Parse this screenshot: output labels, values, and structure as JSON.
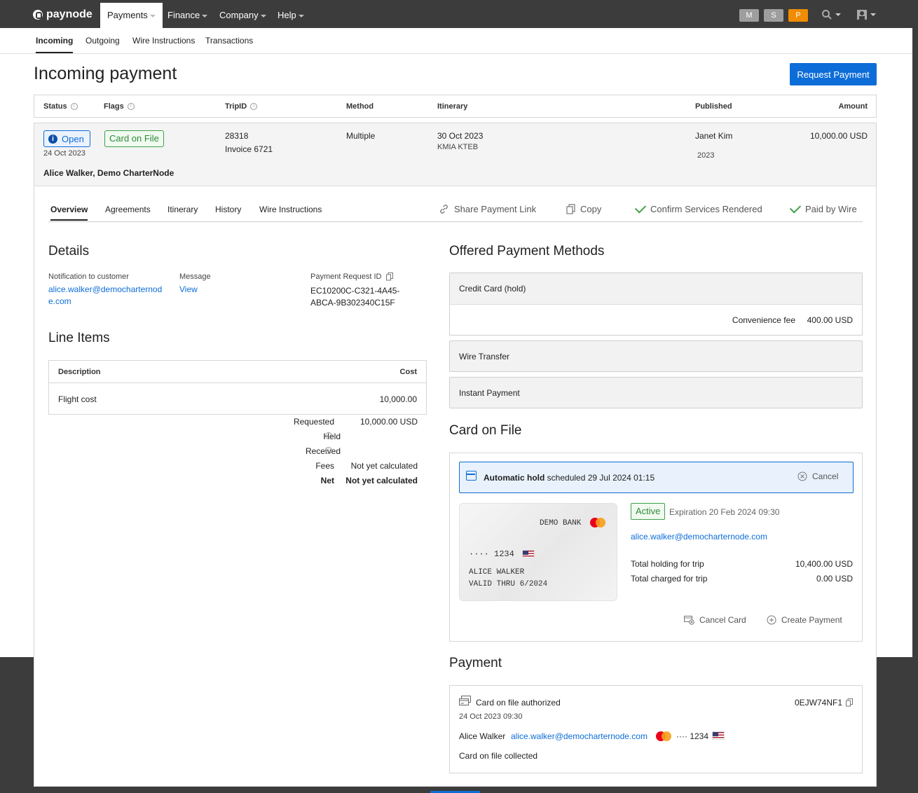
{
  "brand": {
    "name": "paynode"
  },
  "nav": {
    "items": [
      {
        "label": "Payments"
      },
      {
        "label": "Finance"
      },
      {
        "label": "Company"
      },
      {
        "label": "Help"
      }
    ],
    "pills": [
      {
        "label": "M",
        "color": "#9e9e9e"
      },
      {
        "label": "S",
        "color": "#9e9e9e"
      },
      {
        "label": "P",
        "color": "#f08c00"
      }
    ]
  },
  "subnav": [
    "Incoming",
    "Outgoing",
    "Wire Instructions",
    "Transactions"
  ],
  "page": {
    "title": "Incoming payment",
    "primary_button": "Request Payment"
  },
  "summary": {
    "headers": {
      "status": "Status",
      "flags": "Flags",
      "tripid": "TripID",
      "method": "Method",
      "itinerary": "Itinerary",
      "published": "Published",
      "amount": "Amount"
    },
    "status": "Open",
    "status_date": "24 Oct 2023",
    "flag": "Card on File",
    "trip_id": "28318",
    "invoice": "Invoice 6721",
    "method": "Multiple",
    "itinerary_date": "30 Oct 2023",
    "itinerary_route": "KMIA KTEB",
    "published_by": "Janet Kim",
    "published_year": "2023",
    "amount": "10,000.00 USD",
    "customer": "Alice Walker, Demo CharterNode"
  },
  "tabs": [
    "Overview",
    "Agreements",
    "Itinerary",
    "History",
    "Wire Instructions"
  ],
  "actions": {
    "share": "Share Payment Link",
    "copy": "Copy",
    "confirm": "Confirm Services Rendered",
    "paid_wire": "Paid by Wire"
  },
  "details": {
    "title": "Details",
    "notification_label": "Notification to customer",
    "notification_line1": "alice.walker@democharternod",
    "notification_line2": "e.com",
    "message_label": "Message",
    "message_link": "View",
    "request_id_label": "Payment Request ID",
    "request_id_line1": "EC10200C-C321-4A45-",
    "request_id_line2": "ABCA-9B302340C15F"
  },
  "line_items": {
    "title": "Line Items",
    "headers": {
      "description": "Description",
      "cost": "Cost"
    },
    "rows": [
      {
        "description": "Flight cost",
        "cost": "10,000.00"
      }
    ],
    "totals": {
      "requested_label": "Requested",
      "requested_value": "10,000.00 USD",
      "held_label": "Held",
      "received_label": "Received",
      "fees_label": "Fees",
      "fees_value": "Not yet calculated",
      "net_label": "Net",
      "net_value": "Not yet calculated"
    }
  },
  "payment_methods": {
    "title": "Offered Payment Methods",
    "credit_card": "Credit Card (hold)",
    "convenience_label": "Convenience fee",
    "convenience_value": "400.00 USD",
    "wire": "Wire Transfer",
    "instant": "Instant Payment"
  },
  "card_on_file": {
    "title": "Card on File",
    "hold_bold": "Automatic hold",
    "hold_text": "scheduled 29 Jul 2024 01:15",
    "cancel": "Cancel",
    "bank": "DEMO BANK",
    "number": "···· 1234",
    "holder": "ALICE WALKER",
    "valid": "VALID THRU 6/2024",
    "status": "Active",
    "expiration": "Expiration 20 Feb 2024 09:30",
    "email": "alice.walker@democharternode.com",
    "holding_label": "Total holding for trip",
    "holding_value": "10,400.00 USD",
    "charged_label": "Total charged for trip",
    "charged_value": "0.00 USD",
    "cancel_card": "Cancel Card",
    "create_payment": "Create Payment"
  },
  "payment": {
    "title": "Payment",
    "event": "Card on file authorized",
    "code": "0EJW74NF1",
    "date": "24 Oct 2023 09:30",
    "name": "Alice Walker",
    "email": "alice.walker@democharternode.com",
    "card": "···· 1234",
    "note": "Card on file collected"
  }
}
